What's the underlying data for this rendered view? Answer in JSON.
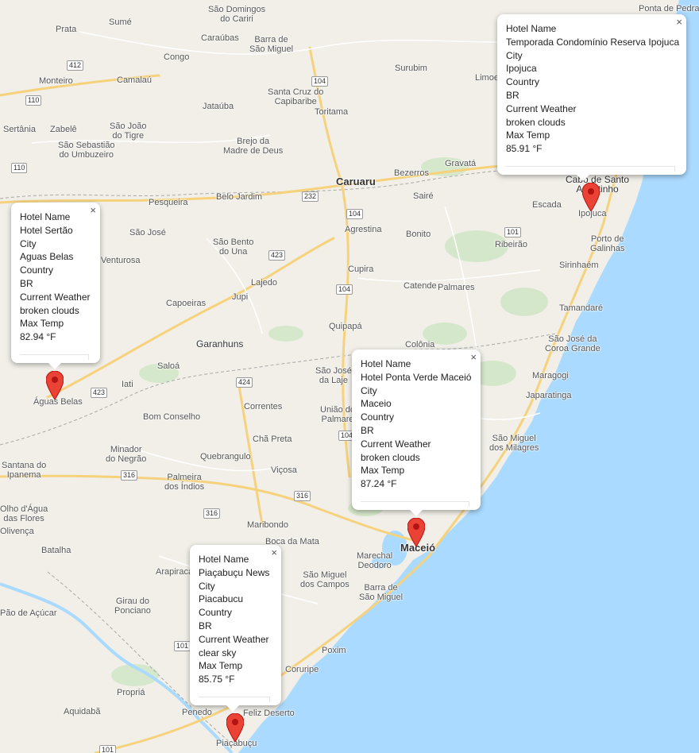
{
  "map": {
    "water_color": "#aadaff",
    "land_color": "#f1efe8",
    "road_color": "#f6d27d",
    "marker_color": "#ea4335",
    "places": [
      {
        "text": "Sumé"
      },
      {
        "text": "Prata"
      },
      {
        "text": "São Domingos do Cariri"
      },
      {
        "text": "Caraúbas"
      },
      {
        "text": "Barra de São Miguel"
      },
      {
        "text": "Congo"
      },
      {
        "text": "Surubim"
      },
      {
        "text": "Monteiro"
      },
      {
        "text": "Camalaú"
      },
      {
        "text": "Santa Cruz do Capibaribe"
      },
      {
        "text": "Toritama"
      },
      {
        "text": "Limoeiro"
      },
      {
        "text": "Sertânia"
      },
      {
        "text": "Zabelê"
      },
      {
        "text": "São João do Tigre"
      },
      {
        "text": "Jataúba"
      },
      {
        "text": "São Sebastião do Umbuzeiro"
      },
      {
        "text": "Brejo da Madre de Deus"
      },
      {
        "text": "Gravatá"
      },
      {
        "text": "Bezerros"
      },
      {
        "text": "Caruaru"
      },
      {
        "text": "Belo Jardim"
      },
      {
        "text": "Pesqueira"
      },
      {
        "text": "Sairé"
      },
      {
        "text": "Escada"
      },
      {
        "text": "São José"
      },
      {
        "text": "Agrestina"
      },
      {
        "text": "Bonito"
      },
      {
        "text": "Ribeirão"
      },
      {
        "text": "Porto de Galinhas"
      },
      {
        "text": "Venturosa"
      },
      {
        "text": "São Bento do Una"
      },
      {
        "text": "Sirinhaém"
      },
      {
        "text": "Cupira"
      },
      {
        "text": "Lajedo"
      },
      {
        "text": "Catende"
      },
      {
        "text": "Palmares"
      },
      {
        "text": "Capoeiras"
      },
      {
        "text": "Jupi"
      },
      {
        "text": "Tamandaré"
      },
      {
        "text": "Quipapá"
      },
      {
        "text": "São José da Coroa Grande"
      },
      {
        "text": "Garanhuns"
      },
      {
        "text": "Colônia"
      },
      {
        "text": "Saloá"
      },
      {
        "text": "São José da Laje"
      },
      {
        "text": "Maragogi"
      },
      {
        "text": "Iati"
      },
      {
        "text": "Águas Belas"
      },
      {
        "text": "Japaratinga"
      },
      {
        "text": "Correntes"
      },
      {
        "text": "União dos Palmares"
      },
      {
        "text": "Bom Conselho"
      },
      {
        "text": "Chã Preta"
      },
      {
        "text": "São Miguel dos Milagres"
      },
      {
        "text": "Minador do Negrão"
      },
      {
        "text": "Santana do Ipanema"
      },
      {
        "text": "Quebrangulo"
      },
      {
        "text": "Palmeira dos Índios"
      },
      {
        "text": "Viçosa"
      },
      {
        "text": "Olho d'Água das Flores"
      },
      {
        "text": "Olivença"
      },
      {
        "text": "Maribondo"
      },
      {
        "text": "Batalha"
      },
      {
        "text": "Boca da Mata"
      },
      {
        "text": "Maceió"
      },
      {
        "text": "Arapiraca"
      },
      {
        "text": "Marechal Deodoro"
      },
      {
        "text": "São Miguel dos Campos"
      },
      {
        "text": "Barra de São Miguel"
      },
      {
        "text": "Girau do Ponciano"
      },
      {
        "text": "Pão de Açúcar"
      },
      {
        "text": "Poxim"
      },
      {
        "text": "Coruripe"
      },
      {
        "text": "Propriá"
      },
      {
        "text": "Penedo"
      },
      {
        "text": "Feliz Deserto"
      },
      {
        "text": "Aquidabã"
      },
      {
        "text": "Piaçabuçu"
      },
      {
        "text": "Cabo de Santo Agostinho"
      },
      {
        "text": "Ipojuca"
      },
      {
        "text": "Ponta de Pedras"
      }
    ],
    "shields": [
      "412",
      "110",
      "104",
      "232",
      "104",
      "101",
      "423",
      "104",
      "424",
      "423",
      "104",
      "316",
      "316",
      "316",
      "101",
      "101",
      "110"
    ]
  },
  "popups": [
    {
      "lines": [
        "Hotel Name",
        "Temporada Condomínio Reserva Ipojuca",
        "City",
        "Ipojuca",
        "Country",
        "BR",
        "Current Weather",
        "broken clouds",
        "Max Temp",
        "85.91 °F"
      ],
      "close": "×"
    },
    {
      "lines": [
        "Hotel Name",
        "Hotel Sertão",
        "City",
        "Aguas Belas",
        "Country",
        "BR",
        "Current Weather",
        "broken clouds",
        "Max Temp",
        "82.94 °F"
      ],
      "close": "×"
    },
    {
      "lines": [
        "Hotel Name",
        "Hotel Ponta Verde Maceió",
        "City",
        "Maceio",
        "Country",
        "BR",
        "Current Weather",
        "broken clouds",
        "Max Temp",
        "87.24 °F"
      ],
      "close": "×"
    },
    {
      "lines": [
        "Hotel Name",
        "Piaçabuçu News",
        "City",
        "Piacabucu",
        "Country",
        "BR",
        "Current Weather",
        "clear sky",
        "Max Temp",
        "85.75 °F"
      ],
      "close": "×"
    }
  ]
}
